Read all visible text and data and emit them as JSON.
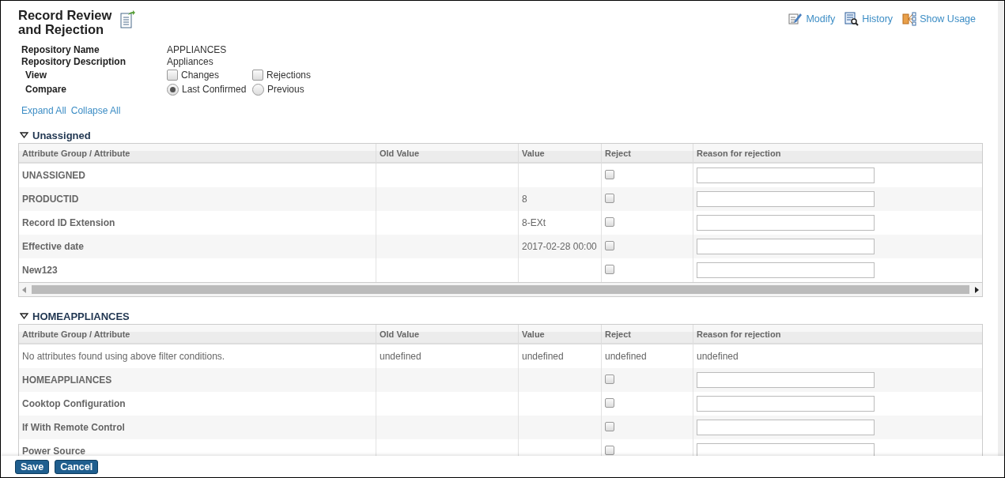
{
  "page_title": "Record Review and Rejection",
  "header_links": [
    {
      "kind": "modify",
      "label": "Modify"
    },
    {
      "kind": "history",
      "label": "History"
    },
    {
      "kind": "usage",
      "label": "Show Usage"
    }
  ],
  "info": [
    {
      "label": "Repository Name",
      "value": "APPLIANCES"
    },
    {
      "label": "Repository Description",
      "value": "Appliances"
    }
  ],
  "view": {
    "label": "View",
    "options": [
      {
        "label": "Changes",
        "checked": false
      },
      {
        "label": "Rejections",
        "checked": false
      }
    ]
  },
  "compare": {
    "label": "Compare",
    "options": [
      {
        "label": "Last Confirmed",
        "selected": true
      },
      {
        "label": "Previous",
        "selected": false
      }
    ]
  },
  "expand_links": [
    "Expand All",
    "Collapse All"
  ],
  "sections": [
    {
      "title": "Unassigned",
      "expanded": true,
      "horizontal_scrollbar": true,
      "columns": [
        "Attribute Group / Attribute",
        "Old Value",
        "Value",
        "Reject",
        "Reason for rejection"
      ],
      "rows": [
        {
          "kind": "attribute",
          "name": "UNASSIGNED",
          "checked": false
        },
        {
          "kind": "attribute",
          "name": "PRODUCTID",
          "value": "8",
          "checked": false
        },
        {
          "kind": "attribute",
          "name": "Record ID Extension",
          "value": "8-EXt",
          "checked": false
        },
        {
          "kind": "attribute",
          "name": "Effective date",
          "value": "2017-02-28 00:00",
          "checked": false
        },
        {
          "kind": "attribute",
          "name": "New123",
          "checked": false
        }
      ]
    },
    {
      "title": "HOMEAPPLIANCES",
      "expanded": true,
      "horizontal_scrollbar": false,
      "columns": [
        "Attribute Group / Attribute",
        "Old Value",
        "Value",
        "Reject",
        "Reason for rejection"
      ],
      "rows": [
        {
          "kind": "message",
          "cells": [
            "No attributes found using above filter conditions.",
            "undefined",
            "undefined",
            "undefined",
            "undefined"
          ]
        },
        {
          "kind": "attribute",
          "name": "HOMEAPPLIANCES",
          "checked": false
        },
        {
          "kind": "attribute",
          "name": "Cooktop Configuration",
          "checked": false
        },
        {
          "kind": "attribute",
          "name": "If With Remote Control",
          "checked": false
        },
        {
          "kind": "attribute",
          "name": "Power Source",
          "checked": false
        }
      ]
    }
  ],
  "footer_buttons": [
    "Save",
    "Cancel"
  ]
}
